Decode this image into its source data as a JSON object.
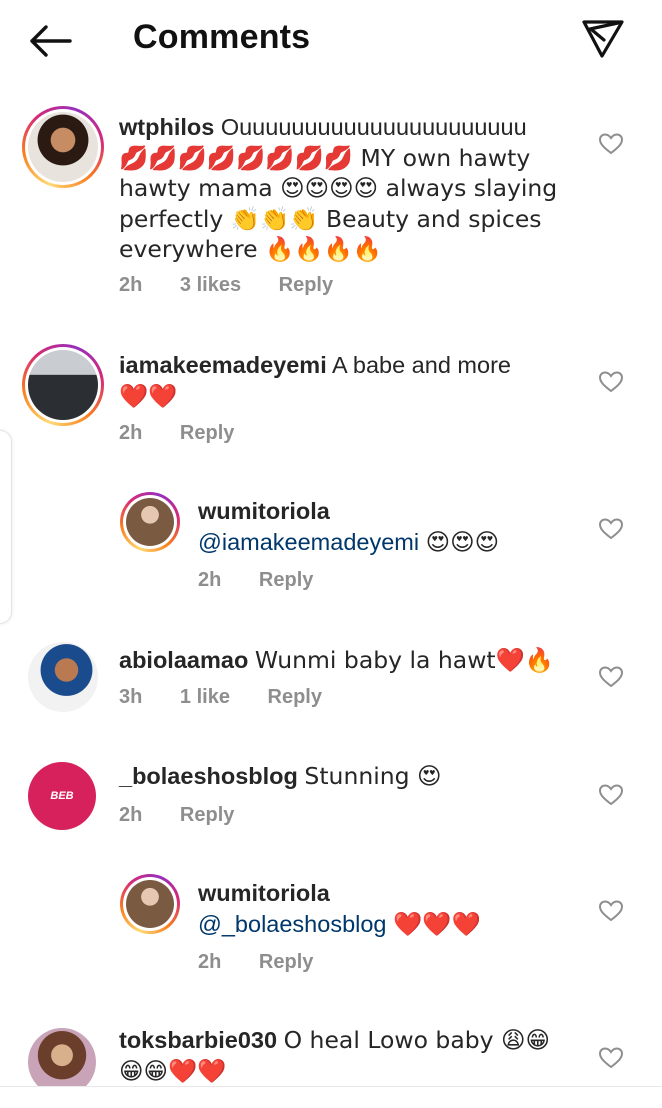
{
  "header": {
    "title": "Comments"
  },
  "comments": [
    {
      "username": "wtphilos",
      "text_lines": [
        "Ouuuuuuuuuuuuuuuuuuuuuu",
        "💋💋💋💋💋💋💋💋 MY own hawty",
        "hawty mama 😍😍😍😍 always slaying",
        "perfectly 👏👏👏 Beauty and spices",
        "everywhere 🔥🔥🔥🔥"
      ],
      "time": "2h",
      "likes": "3 likes",
      "reply": "Reply"
    },
    {
      "username": "iamakeemadeyemi",
      "text_lines": [
        "A babe and more",
        "❤️❤️"
      ],
      "time": "2h",
      "reply": "Reply"
    },
    {
      "username": "wumitoriola",
      "mention": "@iamakeemadeyemi",
      "after_mention": "😍😍😍",
      "time": "2h",
      "reply": "Reply"
    },
    {
      "username": "abiolaamao",
      "text_lines": [
        "Wunmi baby la hawt❤️🔥"
      ],
      "time": "3h",
      "likes": "1 like",
      "reply": "Reply"
    },
    {
      "username": "_bolaeshosblog",
      "avatar_text": "BEB",
      "text_lines": [
        "Stunning 😍"
      ],
      "time": "2h",
      "reply": "Reply"
    },
    {
      "username": "wumitoriola",
      "mention": "@_bolaeshosblog",
      "after_mention": "❤️❤️❤️",
      "time": "2h",
      "reply": "Reply"
    },
    {
      "username": "toksbarbie030",
      "text_lines": [
        "O heal Lowo baby 😩😁",
        "😁😁❤️❤️"
      ]
    }
  ],
  "icons": {
    "back": "arrow-left-icon",
    "send": "paper-plane-icon",
    "like": "heart-outline-icon"
  },
  "colors": {
    "mention": "#00376b",
    "meta": "#8e8e8e",
    "avatar_badge": "#d6215d"
  }
}
